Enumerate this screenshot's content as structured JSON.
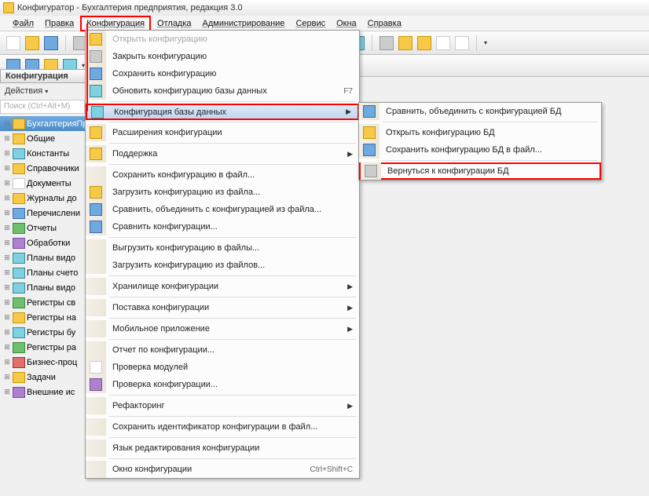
{
  "title": "Конфигуратор - Бухгалтерия предприятия, редакция 3.0",
  "menubar": [
    "Файл",
    "Правка",
    "Конфигурация",
    "Отладка",
    "Администрирование",
    "Сервис",
    "Окна",
    "Справка"
  ],
  "pane": {
    "title": "Конфигурация",
    "actions": "Действия",
    "search": "Поиск (Ctrl+Alt+M)"
  },
  "tree": [
    {
      "label": "БухгалтерияПре",
      "sel": true
    },
    {
      "label": "Общие"
    },
    {
      "label": "Константы"
    },
    {
      "label": "Справочники"
    },
    {
      "label": "Документы"
    },
    {
      "label": "Журналы до"
    },
    {
      "label": "Перечислени"
    },
    {
      "label": "Отчеты"
    },
    {
      "label": "Обработки"
    },
    {
      "label": "Планы видо"
    },
    {
      "label": "Планы счето"
    },
    {
      "label": "Планы видо"
    },
    {
      "label": "Регистры св"
    },
    {
      "label": "Регистры на"
    },
    {
      "label": "Регистры бу"
    },
    {
      "label": "Регистры ра"
    },
    {
      "label": "Бизнес-проц"
    },
    {
      "label": "Задачи"
    },
    {
      "label": "Внешние ис"
    }
  ],
  "menu": [
    {
      "t": "Открыть конфигурацию",
      "dis": true
    },
    {
      "t": "Закрыть конфигурацию"
    },
    {
      "t": "Сохранить конфигурацию"
    },
    {
      "t": "Обновить конфигурацию базы данных",
      "sc": "F7"
    },
    {
      "sep": true
    },
    {
      "t": "Конфигурация базы данных",
      "arr": true,
      "hi": true,
      "red": true
    },
    {
      "sep": true
    },
    {
      "t": "Расширения конфигурации"
    },
    {
      "sep": true
    },
    {
      "t": "Поддержка",
      "arr": true
    },
    {
      "sep": true
    },
    {
      "t": "Сохранить конфигурацию в файл..."
    },
    {
      "t": "Загрузить конфигурацию из файла..."
    },
    {
      "t": "Сравнить, объединить с конфигурацией из файла..."
    },
    {
      "t": "Сравнить конфигурации..."
    },
    {
      "sep": true
    },
    {
      "t": "Выгрузить конфигурацию в файлы..."
    },
    {
      "t": "Загрузить конфигурацию из файлов..."
    },
    {
      "sep": true
    },
    {
      "t": "Хранилище конфигурации",
      "arr": true
    },
    {
      "sep": true
    },
    {
      "t": "Поставка конфигурации",
      "arr": true
    },
    {
      "sep": true
    },
    {
      "t": "Мобильное приложение",
      "arr": true
    },
    {
      "sep": true
    },
    {
      "t": "Отчет по конфигурации..."
    },
    {
      "t": "Проверка модулей"
    },
    {
      "t": "Проверка конфигурации..."
    },
    {
      "sep": true
    },
    {
      "t": "Рефакторинг",
      "arr": true
    },
    {
      "sep": true
    },
    {
      "t": "Сохранить идентификатор конфигурации в файл..."
    },
    {
      "sep": true
    },
    {
      "t": "Язык редактирования конфигурации"
    },
    {
      "sep": true
    },
    {
      "t": "Окно конфигурации",
      "sc": "Ctrl+Shift+C"
    }
  ],
  "submenu": [
    {
      "t": "Сравнить, объединить с конфигурацией БД"
    },
    {
      "sep": true
    },
    {
      "t": "Открыть конфигурацию БД"
    },
    {
      "t": "Сохранить конфигурацию БД в файл..."
    },
    {
      "sep": true
    },
    {
      "t": "Вернуться к конфигурации БД",
      "red": true
    }
  ]
}
